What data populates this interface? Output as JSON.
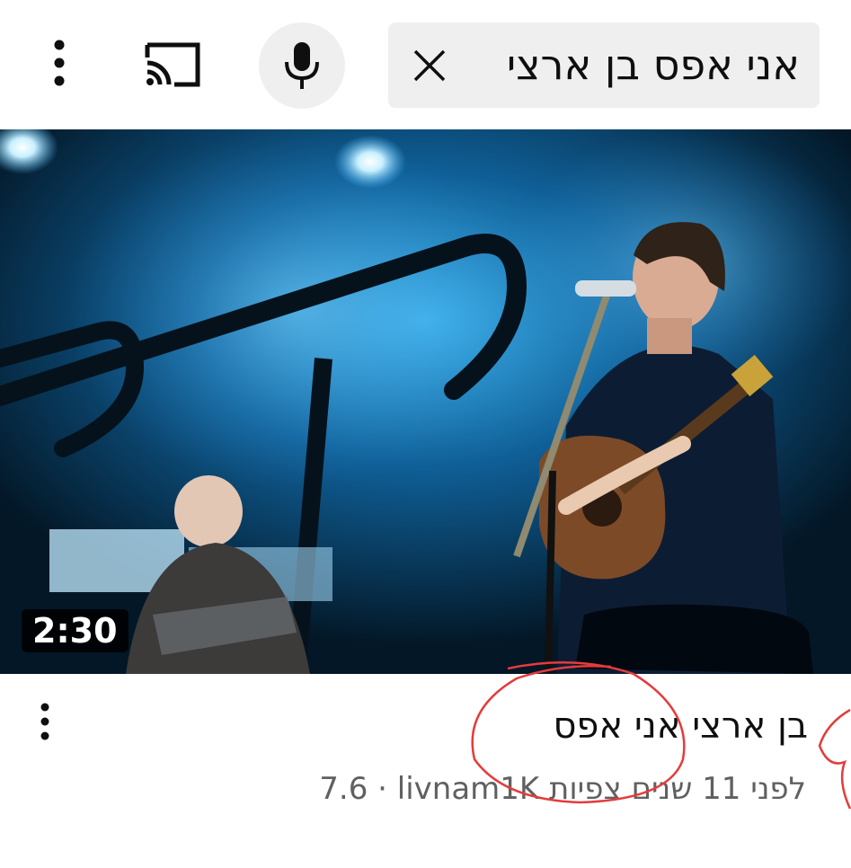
{
  "search": {
    "query": "אני אפס בן ארצי"
  },
  "video": {
    "duration": "2:30",
    "title": "בן ארצי אני אפס",
    "channel": "livnam1K",
    "views": "7.6",
    "age": "לפני 11 שנים צפיות"
  },
  "icons": {
    "menu": "vertical-dots-icon",
    "cast": "cast-icon",
    "mic": "microphone-icon",
    "clear": "close-icon",
    "more": "vertical-dots-icon"
  },
  "colors": {
    "search_bg": "#efefef",
    "annotation": "#e53b3b"
  }
}
